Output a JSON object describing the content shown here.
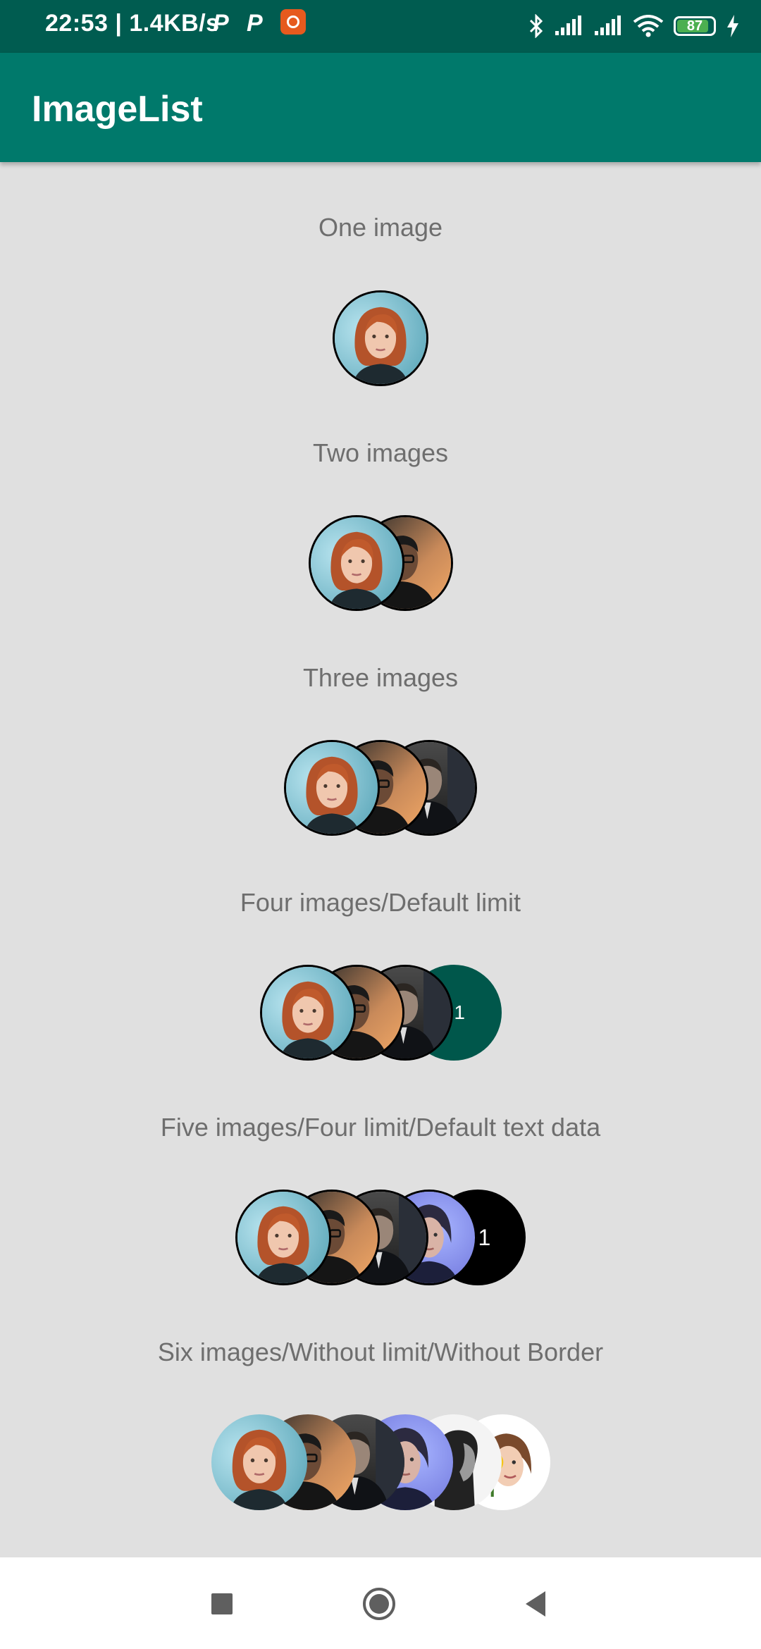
{
  "status_bar": {
    "time": "22:53 | 1.4KB/s",
    "p_icons": [
      "P",
      "P"
    ],
    "battery_level": "87",
    "battery_fraction": 0.87,
    "icons": [
      "parking-p-icon",
      "parking-p-icon",
      "app-notification-icon",
      "bluetooth-icon",
      "signal-icon",
      "signal-icon",
      "wifi-icon",
      "battery-icon",
      "charging-bolt-icon"
    ]
  },
  "app_bar": {
    "title": "ImageList",
    "color": "#00796b"
  },
  "sections": [
    {
      "label": "One image"
    },
    {
      "label": "Two images"
    },
    {
      "label": "Three images"
    },
    {
      "label": "Four images/Default limit",
      "counter": "+1",
      "counter_color": "#00574b"
    },
    {
      "label": "Five images/Four limit/Default text data",
      "counter": "+1",
      "counter_color": "#000000"
    },
    {
      "label": "Six images/Without limit/Without Border"
    }
  ],
  "avatars": [
    "redhead-woman",
    "man-glasses-sunset",
    "man-dark-suit",
    "woman-blue-light",
    "man-profile-bw",
    "woman-sunflower"
  ],
  "nav_bar": {
    "icons": [
      "recents-square-icon",
      "home-circle-icon",
      "back-triangle-icon"
    ]
  }
}
